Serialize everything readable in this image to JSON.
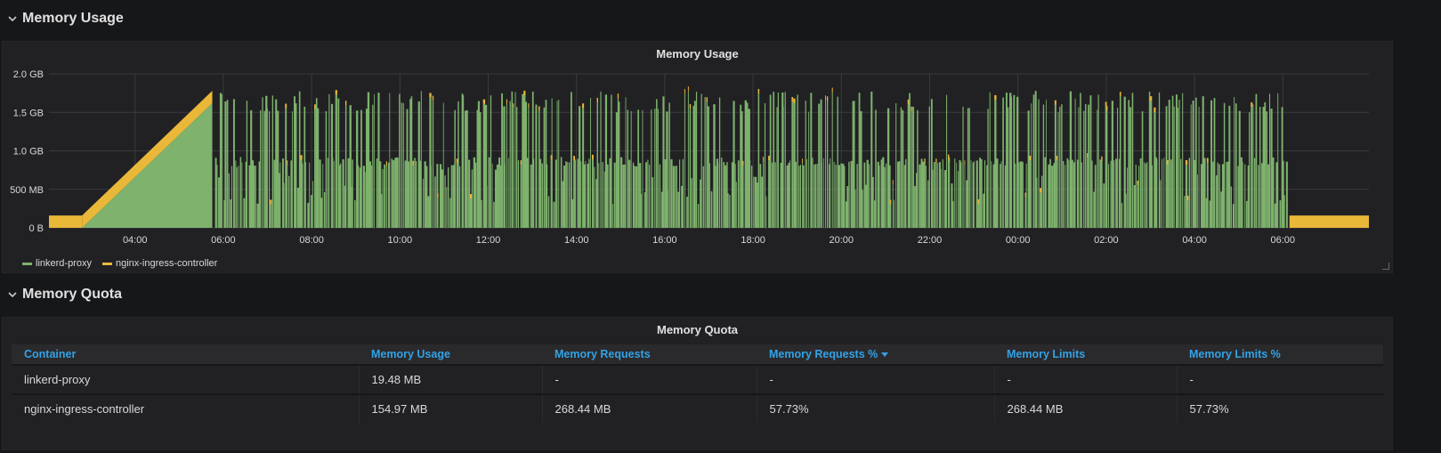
{
  "rows": {
    "usage_row_title": "Memory Usage",
    "quota_row_title": "Memory Quota"
  },
  "usage_panel": {
    "title": "Memory Usage"
  },
  "quota_panel": {
    "title": "Memory Quota",
    "columns": [
      {
        "label": "Container",
        "sorted": false
      },
      {
        "label": "Memory Usage",
        "sorted": false
      },
      {
        "label": "Memory Requests",
        "sorted": false
      },
      {
        "label": "Memory Requests %",
        "sorted": true
      },
      {
        "label": "Memory Limits",
        "sorted": false
      },
      {
        "label": "Memory Limits %",
        "sorted": false
      }
    ],
    "rows": [
      [
        "linkerd-proxy",
        "19.48 MB",
        "-",
        "-",
        "-",
        "-"
      ],
      [
        "nginx-ingress-controller",
        "154.97 MB",
        "268.44 MB",
        "57.73%",
        "268.44 MB",
        "57.73%"
      ]
    ]
  },
  "colors": {
    "linkerd": "#7eb26d",
    "nginx": "#eab839",
    "header_link": "#33a2e5"
  },
  "icons": {
    "row_toggle": "chevron-down-icon",
    "sort": "caret-down-icon",
    "resize": "resize-handle-icon"
  },
  "chart_data": {
    "type": "area",
    "title": "Memory Usage",
    "stacked": true,
    "y_ticks": [
      "0 B",
      "500 MB",
      "1.0 GB",
      "1.5 GB",
      "2.0 GB"
    ],
    "ylim_gb": [
      0,
      2.0
    ],
    "x_ticks": [
      "04:00",
      "06:00",
      "08:00",
      "10:00",
      "12:00",
      "14:00",
      "16:00",
      "18:00",
      "20:00",
      "22:00",
      "00:00",
      "02:00",
      "04:00",
      "06:00"
    ],
    "x_range_hours": [
      2.05,
      7.95
    ],
    "grid": true,
    "legend_placement": "bottom-left",
    "series": [
      {
        "name": "linkerd-proxy",
        "color": "#7eb26d",
        "description_points": [
          {
            "t": 2.05,
            "gb": 0
          },
          {
            "t": 2.8,
            "gb": 0
          },
          {
            "t": 5.75,
            "gb": 1.62
          },
          {
            "t": 5.76,
            "gb": 0
          }
        ],
        "spikes_range": {
          "from": 5.8,
          "to": 30.1,
          "typical_gb": [
            0.85,
            1.75
          ]
        }
      },
      {
        "name": "nginx-ingress-controller",
        "color": "#eab839",
        "description_points": [
          {
            "t": 2.05,
            "gb": 0.16
          },
          {
            "t": 2.8,
            "gb": 0.16
          },
          {
            "t": 5.75,
            "gb": 0.16
          },
          {
            "t": 30.1,
            "gb": 0.16
          },
          {
            "t": 31.95,
            "gb": 0.16
          }
        ]
      }
    ]
  }
}
